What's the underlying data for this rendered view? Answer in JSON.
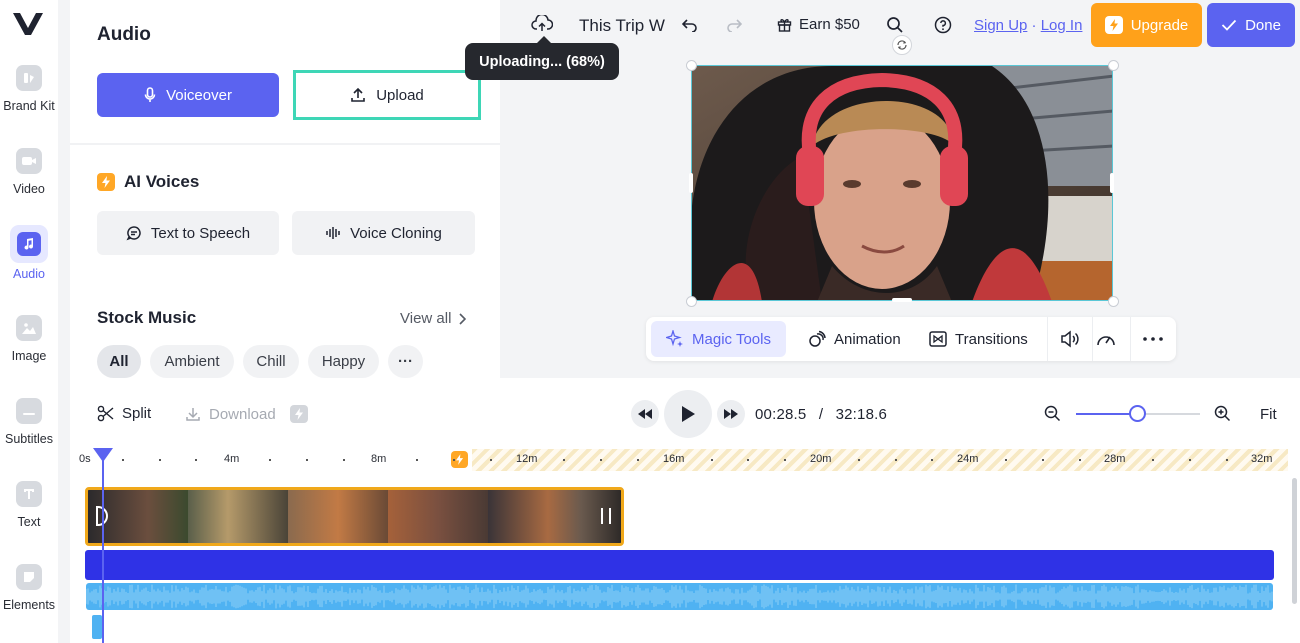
{
  "rail": {
    "items": [
      {
        "label": "Brand Kit"
      },
      {
        "label": "Video"
      },
      {
        "label": "Audio"
      },
      {
        "label": "Image"
      },
      {
        "label": "Subtitles"
      },
      {
        "label": "Text"
      },
      {
        "label": "Elements"
      }
    ],
    "active": "Audio"
  },
  "panel": {
    "title": "Audio",
    "voiceover_label": "Voiceover",
    "upload_label": "Upload",
    "ai_voices_title": "AI Voices",
    "tts_label": "Text to Speech",
    "cloning_label": "Voice Cloning",
    "stock_title": "Stock Music",
    "view_all": "View all",
    "chips": [
      "All",
      "Ambient",
      "Chill",
      "Happy"
    ],
    "more_chip": "···"
  },
  "header": {
    "project_title": "This Trip W",
    "earn_label": "Earn $50",
    "sign_up": "Sign Up",
    "separator": " · ",
    "log_in": "Log In",
    "upgrade_label": "Upgrade",
    "done_label": "Done"
  },
  "upload_tooltip": "Uploading... (68%)",
  "upload_progress_percent": 68,
  "toolbar": {
    "magic_tools": "Magic Tools",
    "animation": "Animation",
    "transitions": "Transitions"
  },
  "timeline": {
    "split_label": "Split",
    "download_label": "Download",
    "current_time": "00:28.5",
    "time_separator": "/",
    "total_time": "32:18.6",
    "fit_label": "Fit",
    "zoom_fraction": 0.5,
    "ruler_labels": [
      "0s",
      "4m",
      "8m",
      "12m",
      "16m",
      "20m",
      "24m",
      "28m",
      "32m"
    ]
  },
  "colors": {
    "accent": "#5b63f0",
    "upgrade": "#ffa11a",
    "upload_highlight": "#3ed6b6",
    "clip_border": "#f0a81a",
    "audio_track": "#2f32e6",
    "waveform": "#4fb2f2"
  }
}
